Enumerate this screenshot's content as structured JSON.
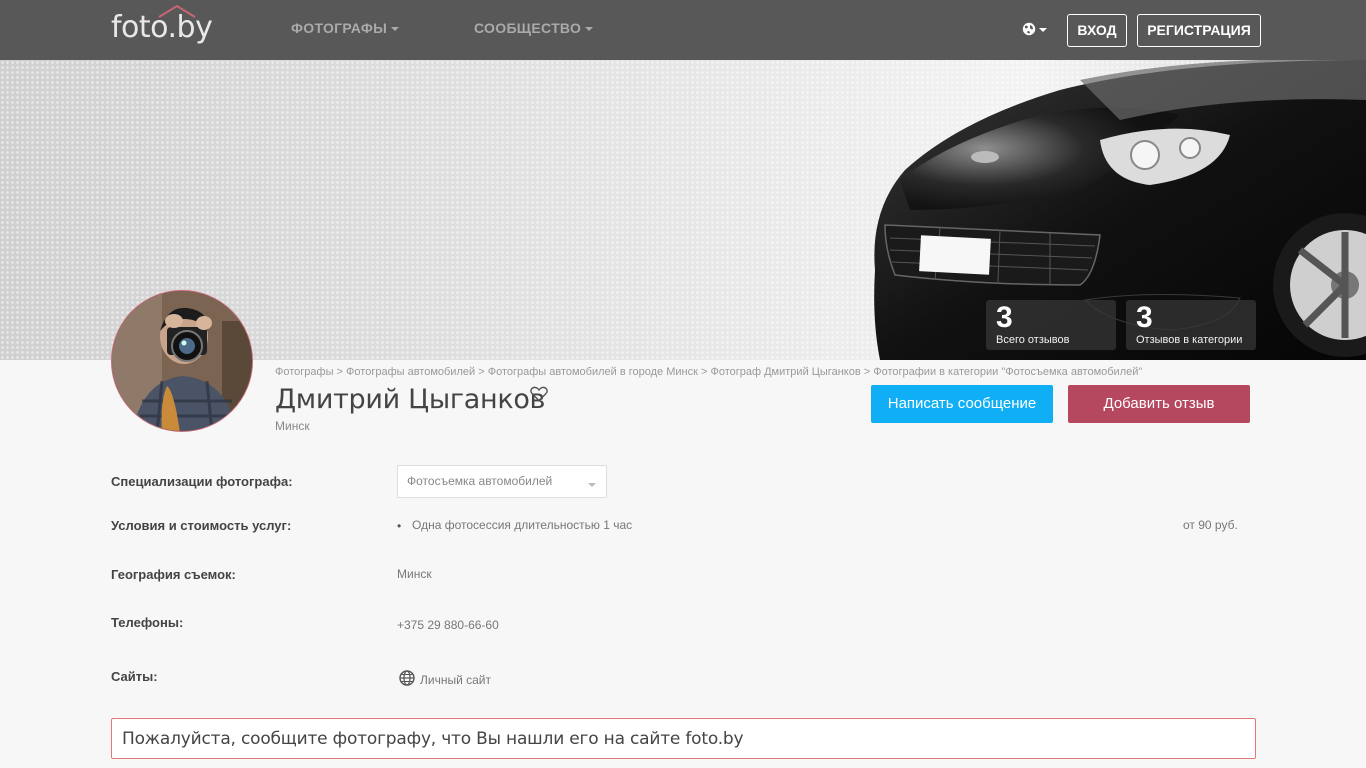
{
  "nav": {
    "logo": "foto.by",
    "menu": [
      {
        "label": "ФОТОГРАФЫ"
      },
      {
        "label": "СООБЩЕСТВО"
      }
    ],
    "login": "ВХОД",
    "register": "РЕГИСТРАЦИЯ"
  },
  "stats": [
    {
      "value": "3",
      "label": "Всего отзывов"
    },
    {
      "value": "3",
      "label": "Отзывов в категории"
    }
  ],
  "breadcrumbs": [
    "Фотографы",
    "Фотографы автомобилей",
    "Фотографы автомобилей в городе Минск",
    "Фотограф Дмитрий Цыганков",
    "Фотографии в категории \"Фотосъемка автомобилей\""
  ],
  "breadcrumb_separator": ">",
  "profile": {
    "name": "Дмитрий Цыганков",
    "city": "Минск",
    "message_button": "Написать сообщение",
    "review_button": "Добавить отзыв"
  },
  "details": {
    "specializations_label": "Специализации фотографа:",
    "specialization_selected": "Фотосъемка автомобилей",
    "services_label": "Условия и стоимость услуг:",
    "service_name": "Одна фотосессия длительностью 1 час",
    "service_price": "от 90 руб.",
    "geography_label": "География съемок:",
    "geography_value": "Минск",
    "phones_label": "Телефоны:",
    "phone_value": "+375 29 880-66-60",
    "sites_label": "Сайты:",
    "site_link": "Личный сайт"
  },
  "notice": "Пожалуйста, сообщите фотографу, что Вы нашли его на сайте foto.by",
  "colors": {
    "nav_bg": "#585858",
    "message_btn": "#10aef5",
    "review_btn": "#b5475f",
    "notice_border": "#e07a7a"
  },
  "icons": [
    "globe-icon",
    "heart-icon",
    "web-icon",
    "chevron-down-icon"
  ]
}
